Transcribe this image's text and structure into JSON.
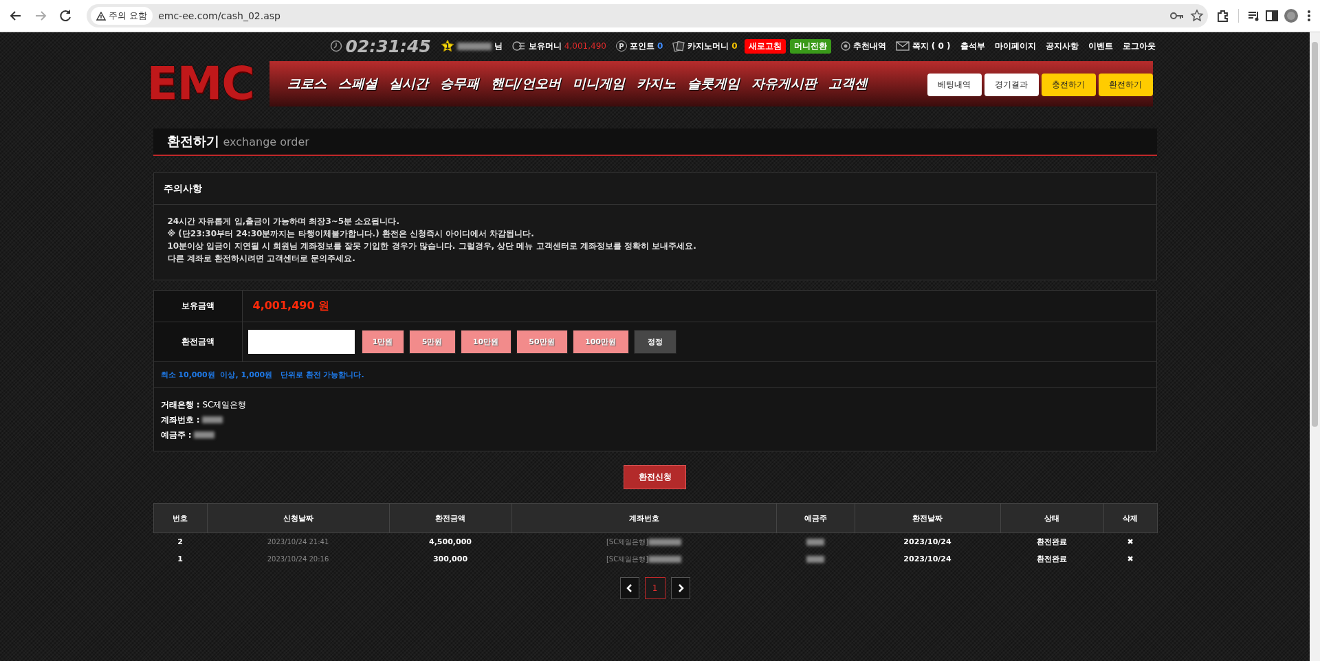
{
  "browser": {
    "security": "주의 요함",
    "url": "emc-ee.com/cash_02.asp"
  },
  "header": {
    "clock": "02:31:45",
    "level": "1",
    "user_suffix": "님",
    "stats": [
      {
        "kind": "money",
        "label": "보유머니",
        "value": "4,001,490"
      },
      {
        "kind": "point",
        "icon_label": "P",
        "label": "포인트",
        "value": "0"
      },
      {
        "kind": "casino",
        "label": "카지노머니",
        "value": "0"
      }
    ],
    "actions": [
      {
        "label": "새로고침",
        "color": "#ff0000"
      },
      {
        "label": "머니전환",
        "color": "#3a9a1a"
      }
    ],
    "links": [
      {
        "kind": "recommend",
        "label": "추천내역"
      },
      {
        "kind": "message",
        "label": "쪽지 ( 0 )"
      },
      {
        "kind": "plain",
        "label": "출석부"
      },
      {
        "kind": "plain",
        "label": "마이페이지"
      },
      {
        "kind": "plain",
        "label": "공지사항"
      },
      {
        "kind": "plain",
        "label": "이벤트"
      },
      {
        "kind": "plain",
        "label": "로그아웃"
      }
    ]
  },
  "logo": "EMC",
  "nav": [
    "크로스",
    "스페셜",
    "실시간",
    "승무패",
    "핸디/언오버",
    "미니게임",
    "카지노",
    "슬롯게임",
    "자유게시판",
    "고객센"
  ],
  "quick_buttons": [
    {
      "label": "베팅내역",
      "kind": "light"
    },
    {
      "label": "경기결과",
      "kind": "light"
    },
    {
      "label": "충전하기",
      "kind": "accent"
    },
    {
      "label": "환전하기",
      "kind": "accent"
    }
  ],
  "page_title": {
    "title": "환전하기",
    "subtitle": "exchange order"
  },
  "notice": {
    "title": "주의사항",
    "lines": [
      "24시간 자유롭게 입,출금이 가능하며 최장3~5분 소요됩니다.",
      "※ (단23:30부터 24:30분까지는 타행이체불가합니다.) 환전은 신청즉시 아이디에서 차감됩니다.",
      "10분이상 입금이 지연될 시 회원님 계좌정보를 잘못 기입한 경우가 많습니다. 그럴경우, 상단 메뉴 고객센터로 계좌정보를 정확히 보내주세요.",
      "다른 계좌로 환전하시려면 고객센터로 문의주세요."
    ]
  },
  "form": {
    "balance_label": "보유금액",
    "balance": "4,001,490 원",
    "amount_label": "환전금액",
    "amount_buttons": [
      "1만원",
      "5만원",
      "10만원",
      "50만원",
      "100만원"
    ],
    "reset_button": "정정",
    "hint": "최소 10,000원  이상, 1,000원   단위로 환전 가능합니다.",
    "bank": [
      {
        "label": "거래은행 :",
        "kind": "text",
        "value": "SC제일은행"
      },
      {
        "label": "계좌번호 :",
        "kind": "blurred"
      },
      {
        "label": "예금주 :",
        "kind": "blurred"
      }
    ]
  },
  "submit_button": "환전신청",
  "history": {
    "columns": [
      "번호",
      "신청날짜",
      "환전금액",
      "계좌번호",
      "예금주",
      "환전날짜",
      "상태",
      "삭제"
    ],
    "rows": [
      {
        "no": "2",
        "requested": "2023/10/24 21:41",
        "amount": "4,500,000",
        "bank": "[SC제일은행]",
        "exchanged": "2023/10/24",
        "status": "환전완료",
        "delete": "✖"
      },
      {
        "no": "1",
        "requested": "2023/10/24 20:16",
        "amount": "300,000",
        "bank": "[SC제일은행]",
        "exchanged": "2023/10/24",
        "status": "환전완료",
        "delete": "✖"
      }
    ]
  },
  "pagination": {
    "pages": [
      {
        "label": "1",
        "selected": true
      }
    ]
  }
}
